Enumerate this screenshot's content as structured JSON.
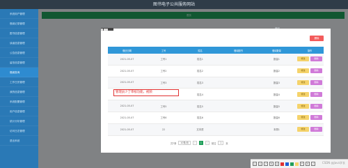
{
  "app": {
    "title": "图书电子公共服务网站"
  },
  "sidebar": {
    "items": [
      {
        "label": "系统用户管理"
      },
      {
        "label": "借阅记录管理"
      },
      {
        "label": "图书信息管理"
      },
      {
        "label": "读者信息管理"
      },
      {
        "label": "公告信息管理"
      },
      {
        "label": "留言信息管理"
      },
      {
        "label": "借阅查询"
      },
      {
        "label": "工作日历管理"
      },
      {
        "label": "我的信息管理"
      },
      {
        "label": "系统配置管理"
      },
      {
        "label": "用户信息管理"
      },
      {
        "label": "统计分析管理"
      },
      {
        "label": "访问日志管理"
      },
      {
        "label": "退出系统"
      }
    ]
  },
  "greenbar": {
    "text": "首页"
  },
  "dialog": {
    "delete_label": "删除",
    "columns": [
      "借还日期",
      "工号",
      "姓名",
      "借阅图书",
      "借阅数量",
      "操作"
    ],
    "rows": [
      {
        "date": "2021-05-07",
        "id": "工号1",
        "name": "姓名1",
        "book": "",
        "qty": "数量1"
      },
      {
        "date": "2021-05-07",
        "id": "工号2",
        "name": "姓名2",
        "book": "",
        "qty": "数量2"
      },
      {
        "date": "2021-05-07",
        "id": "工号3",
        "name": "姓名3",
        "book": "",
        "qty": "数量3"
      },
      {
        "date": "2021-05-07",
        "id": "工号4",
        "name": "姓名4",
        "book": "",
        "qty": "数量4"
      },
      {
        "date": "2021-05-07",
        "id": "工号5",
        "name": "姓名5",
        "book": "",
        "qty": "数量5"
      },
      {
        "date": "2021-05-07",
        "id": "工号6",
        "name": "姓名6",
        "book": "",
        "qty": "数量6"
      },
      {
        "date": "2021-05-07",
        "id": "22",
        "name": "文本质",
        "book": "",
        "qty": "本周1"
      }
    ],
    "edit_label": "修改",
    "del_label": "删除",
    "pager": {
      "total": "共7条",
      "size": "10条/页",
      "page": "1",
      "goto": "前往",
      "goto_page": "1",
      "unit": "页"
    }
  },
  "annotation": "管理员少了审核功能，视频",
  "right_labels": [
    "借阅"
  ],
  "watermark": "CSDN @Java学长",
  "colors": {
    "header": "#2f3c48",
    "sidebar": "#2a79b6",
    "table_header": "#2f97d8",
    "edit": "#f5d36b",
    "delete": "#d07ad8",
    "green": "#1f9e59"
  }
}
